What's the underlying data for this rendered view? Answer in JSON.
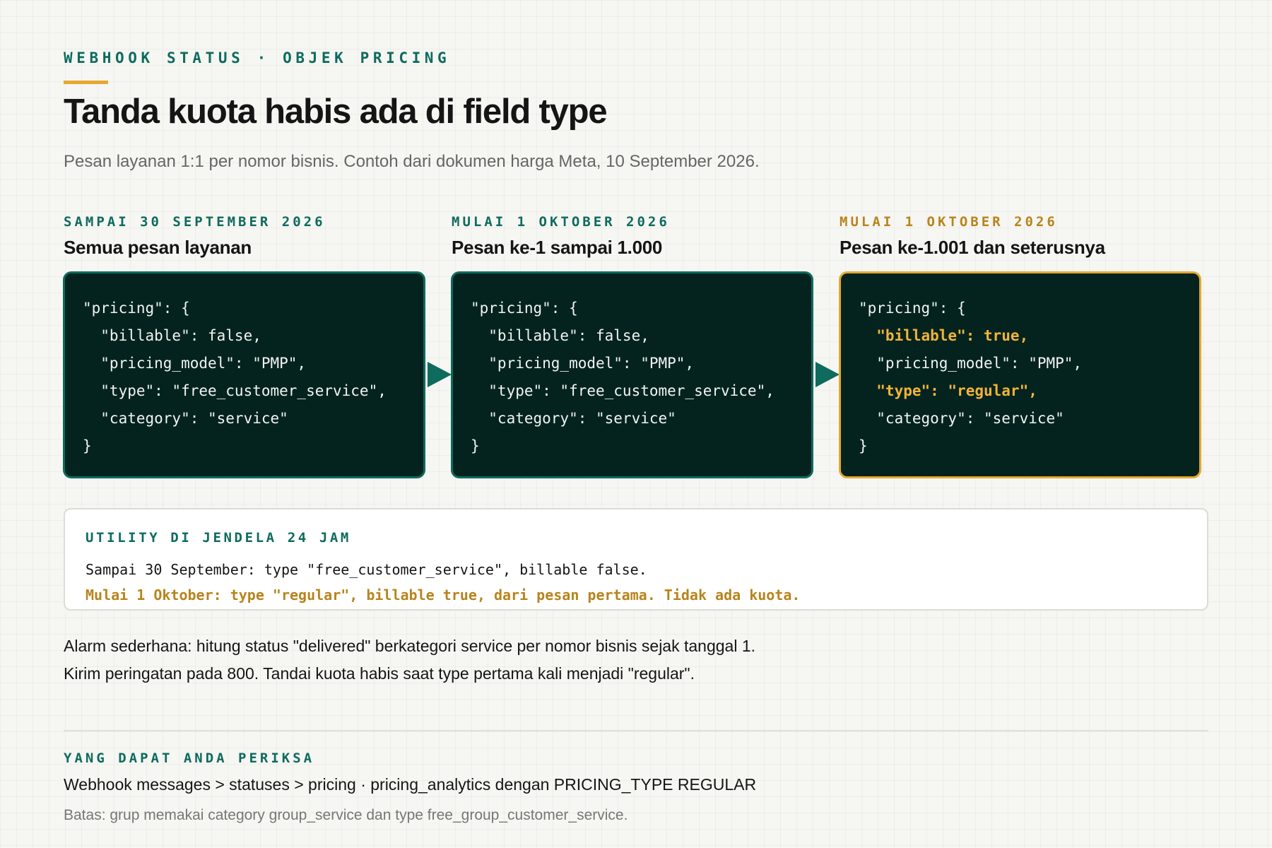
{
  "header": {
    "eyebrow": "WEBHOOK STATUS · OBJEK PRICING",
    "title": "Tanda kuota habis ada di field type",
    "subtitle": "Pesan layanan 1:1 per nomor bisnis. Contoh dari dokumen harga Meta, 10 September 2026."
  },
  "columns": [
    {
      "date": "SAMPAI 30 SEPTEMBER 2026",
      "heading": "Semua pesan layanan",
      "code": [
        "\"pricing\": {",
        "  \"billable\": false,",
        "  \"pricing_model\": \"PMP\",",
        "  \"type\": \"free_customer_service\",",
        "  \"category\": \"service\"",
        "}"
      ]
    },
    {
      "date": "MULAI 1 OKTOBER 2026",
      "heading": "Pesan ke-1 sampai 1.000",
      "code": [
        "\"pricing\": {",
        "  \"billable\": false,",
        "  \"pricing_model\": \"PMP\",",
        "  \"type\": \"free_customer_service\",",
        "  \"category\": \"service\"",
        "}"
      ]
    },
    {
      "date": "MULAI 1 OKTOBER 2026",
      "heading": "Pesan ke-1.001 dan seterusnya",
      "code": [
        "\"pricing\": {",
        "  \"billable\": true,",
        "  \"pricing_model\": \"PMP\",",
        "  \"type\": \"regular\",",
        "  \"category\": \"service\"",
        "}"
      ]
    }
  ],
  "note": {
    "title": "UTILITY DI JENDELA 24 JAM",
    "line1": "Sampai 30 September: type \"free_customer_service\", billable false.",
    "line2": "Mulai 1 Oktober: type \"regular\", billable true, dari pesan pertama. Tidak ada kuota."
  },
  "body": {
    "line1": "Alarm sederhana: hitung status \"delivered\" berkategori service per nomor bisnis sejak tanggal 1.",
    "line2": "Kirim peringatan pada 800. Tandai kuota habis saat type pertama kali menjadi \"regular\"."
  },
  "check": {
    "title": "YANG DAPAT ANDA PERIKSA",
    "line": "Webhook messages > statuses > pricing · pricing_analytics dengan PRICING_TYPE REGULAR",
    "limit": "Batas: grup memakai category group_service dan type free_group_customer_service."
  },
  "colors": {
    "teal": "#0e6b5e",
    "amber": "#e5a830",
    "code_bg": "#04231f"
  }
}
